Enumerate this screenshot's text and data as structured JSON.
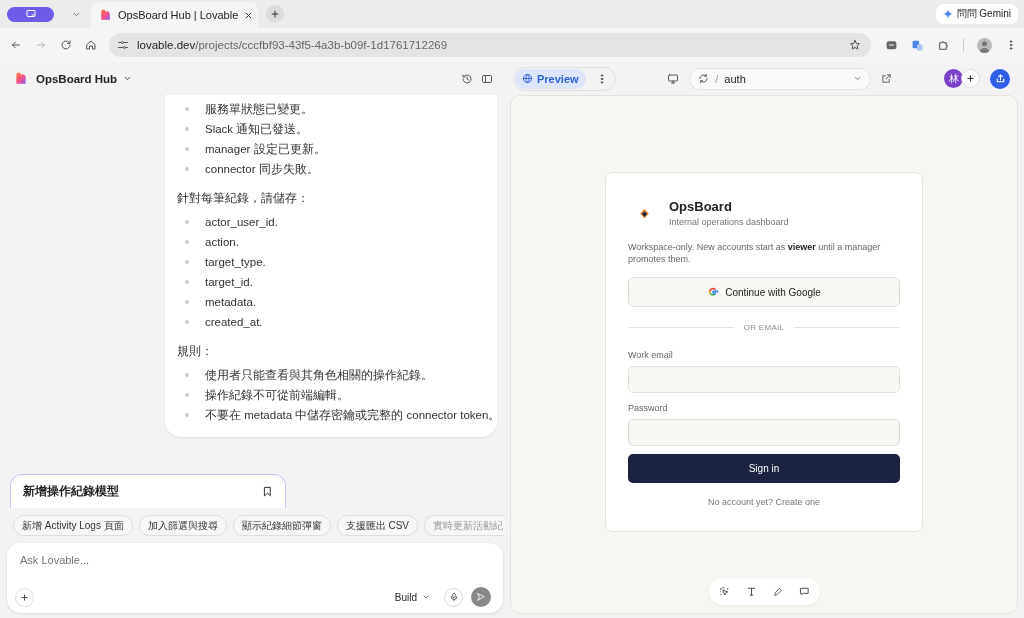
{
  "browser": {
    "tab_title": "OpsBoard Hub | Lovable",
    "url_host": "lovable.dev",
    "url_path": "/projects/cccfbf93-43f5-4a3b-b09f-1d1761712269",
    "gemini_label": "問問 Gemini"
  },
  "app_header": {
    "project": "OpsBoard Hub",
    "view_tabs": [
      {
        "label": "Preview",
        "selected": true
      }
    ],
    "route_separator": "/",
    "route": "auth",
    "avatar": "林"
  },
  "chat": {
    "blocks": [
      {
        "kind": "list",
        "items": [
          "服務單狀態已變更。",
          "Slack 通知已發送。",
          "manager 設定已更新。",
          "connector 同步失敗。"
        ]
      },
      {
        "kind": "paragraph",
        "text": "針對每筆紀錄，請儲存："
      },
      {
        "kind": "list",
        "items": [
          "actor_user_id.",
          "action.",
          "target_type.",
          "target_id.",
          "metadata.",
          "created_at."
        ]
      },
      {
        "kind": "paragraph",
        "text": "規則："
      },
      {
        "kind": "list",
        "items": [
          "使用者只能查看與其角色相關的操作紀錄。",
          "操作紀錄不可從前端編輯。",
          "不要在 metadata 中儲存密鑰或完整的 connector token。"
        ]
      }
    ]
  },
  "suggestion": {
    "title": "新增操作紀錄模型",
    "chips": [
      "新增 Activity Logs 頁面",
      "加入篩選與搜尋",
      "顯示紀錄細節彈窗",
      "支援匯出 CSV",
      "實時更新活動紀"
    ]
  },
  "composer": {
    "placeholder": "Ask Lovable...",
    "mode": "Build"
  },
  "preview": {
    "brand": "OpsBoard",
    "tagline": "Internal operations dashboard",
    "notice": "Workspace-only. New accounts start as **viewer** until a manager promotes them.",
    "google_button": "Continue with Google",
    "divider": "OR EMAIL",
    "fields": [
      {
        "label": "Work email"
      },
      {
        "label": "Password"
      }
    ],
    "submit": "Sign in",
    "footer": "No account yet? Create one"
  }
}
